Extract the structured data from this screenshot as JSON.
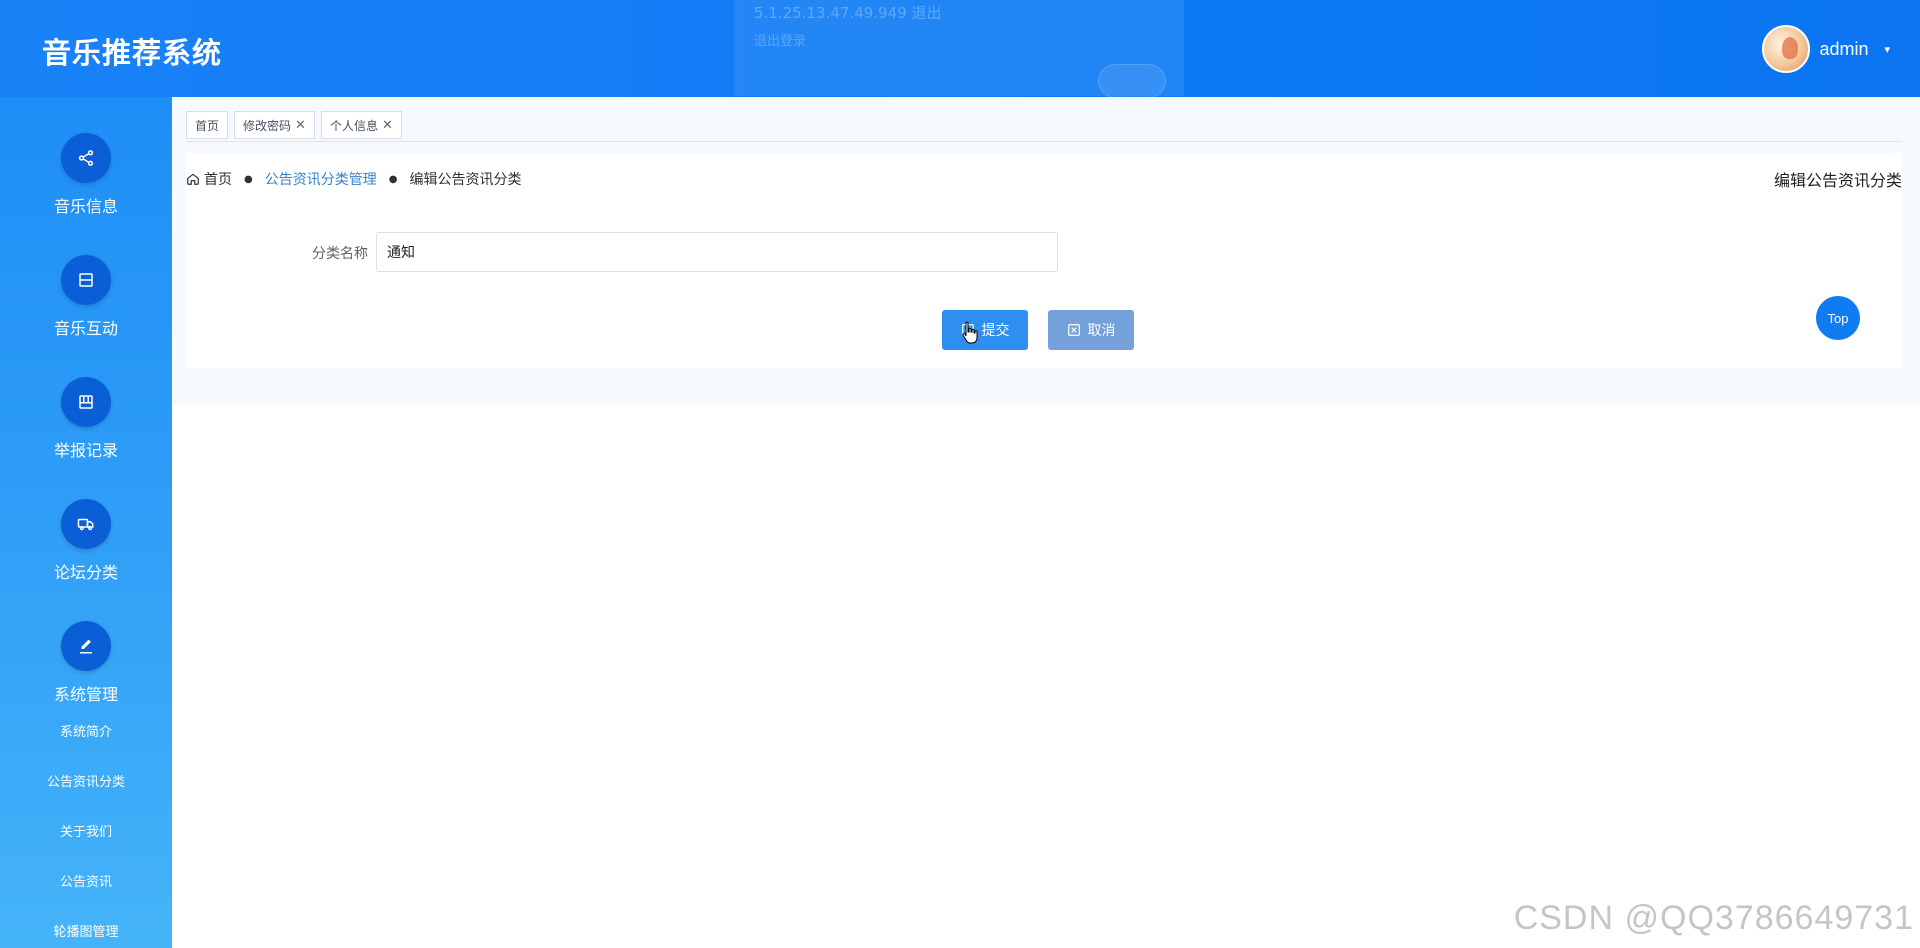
{
  "header": {
    "title": "音乐推荐系统",
    "ghost_popup": {
      "line1": "5.1.25.13.47.49.949 退出",
      "line2": "退出登录"
    },
    "user": {
      "name": "admin",
      "caret": "▾"
    }
  },
  "sidebar": {
    "items": [
      {
        "label": "音乐信息",
        "icon": "share-icon"
      },
      {
        "label": "音乐互动",
        "icon": "collapse-icon"
      },
      {
        "label": "举报记录",
        "icon": "board-icon"
      },
      {
        "label": "论坛分类",
        "icon": "truck-icon"
      },
      {
        "label": "系统管理",
        "icon": "edit-icon"
      }
    ],
    "sub_items": [
      "系统简介",
      "公告资讯分类",
      "关于我们",
      "公告资讯",
      "轮播图管理"
    ]
  },
  "tabs": [
    {
      "label": "首页",
      "closable": false
    },
    {
      "label": "修改密码",
      "closable": true
    },
    {
      "label": "个人信息",
      "closable": true
    }
  ],
  "breadcrumb": {
    "home": "首页",
    "sep": "●",
    "level1": "公告资讯分类管理",
    "level2": "编辑公告资讯分类"
  },
  "page_title": "编辑公告资讯分类",
  "form": {
    "label": "分类名称",
    "value": "通知"
  },
  "buttons": {
    "submit": "提交",
    "cancel": "取消"
  },
  "top_button": "Top",
  "watermark": "CSDN @QQ3786649731",
  "colors": {
    "header": "#0f7bf5",
    "sidebar_top": "#1e8ef7",
    "sidebar_bottom": "#45b4f8",
    "nav_circle": "#0a5fd6",
    "submit": "#2f8ff0",
    "cancel": "#74a1d9"
  }
}
